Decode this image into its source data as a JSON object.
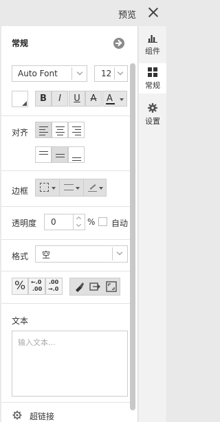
{
  "topbar": {
    "preview": "预览"
  },
  "rightbar": {
    "tabs": [
      {
        "label": "组件",
        "icon": "bar-chart-icon"
      },
      {
        "label": "常规",
        "icon": "grid-icon"
      },
      {
        "label": "设置",
        "icon": "gear-icon"
      }
    ]
  },
  "panel": {
    "title": "常规",
    "font": {
      "family": "Auto Font",
      "size": "12"
    },
    "format_buttons": {
      "bold": "B",
      "italic": "I",
      "underline": "U",
      "strike": "A",
      "color": "A"
    },
    "align_label": "对齐",
    "border_label": "边框",
    "opacity": {
      "label": "透明度",
      "value": "0",
      "unit": "%",
      "auto": "自动"
    },
    "format": {
      "label": "格式",
      "value": "空"
    },
    "number_buttons": {
      "percent": "%",
      "dec_minus_top": "←.0",
      "dec_minus_bottom": ".00",
      "dec_plus_top": ".00",
      "dec_plus_bottom": "→.0"
    },
    "text": {
      "label": "文本",
      "placeholder": "输入文本..."
    },
    "hyperlink": "超链接"
  },
  "colors": {
    "accent_active": "#dcdcdc",
    "text_color_underline": "#e02020"
  }
}
